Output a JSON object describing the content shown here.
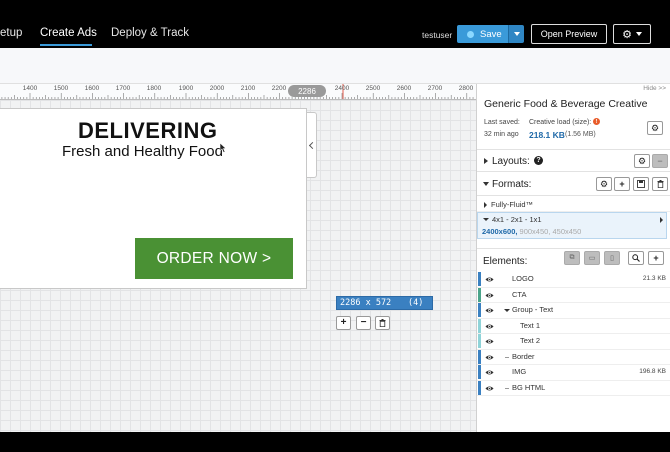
{
  "nav": {
    "tabs": [
      {
        "label": "etup"
      },
      {
        "label": "Create Ads"
      },
      {
        "label": "Deploy & Track"
      }
    ],
    "username": "testuser",
    "save_label": "Save",
    "preview_label": "Open Preview"
  },
  "ruler": {
    "labels": [
      "1400",
      "1500",
      "1600",
      "1700",
      "1800",
      "1900",
      "2000",
      "2100",
      "2200",
      "2400",
      "2500",
      "2600",
      "2700",
      "2800"
    ],
    "marker": "2286"
  },
  "ad": {
    "title": "DELIVERING",
    "subtitle": "Fresh and Healthy Food",
    "cta": "ORDER NOW >",
    "cta_color": "#4a9134"
  },
  "canvas": {
    "size_label": "2286 x 572",
    "size_count": "(4)",
    "tools": [
      "+",
      "−",
      "trash-icon"
    ]
  },
  "panel": {
    "hide_label": "Hide >>",
    "title": "Generic Food & Beverage Creative",
    "last_saved_label": "Last saved:",
    "last_saved_value": "32 min ago",
    "creative_load_label": "Creative load (size):",
    "creative_load_value": "218.1 KB",
    "creative_load_sub": "(1.56 MB)",
    "layouts_label": "Layouts:",
    "formats_label": "Formats:",
    "formats": [
      {
        "label": "Fully-Fluid™"
      },
      {
        "label": "4x1 - 2x1 - 1x1"
      }
    ],
    "format_sizes_active": "2400x600,",
    "format_sizes_rest": " 900x450, 450x450",
    "elements_label": "Elements:",
    "elements": [
      {
        "name": "LOGO",
        "size": "21.3 KB",
        "bar": "#3a80c1"
      },
      {
        "name": "CTA",
        "size": "",
        "bar": "#4aa48a"
      },
      {
        "name": "Group - Text",
        "size": "",
        "bar": "#3a80c1"
      },
      {
        "name": "Text 1",
        "size": "",
        "bar": "#8fd3d8"
      },
      {
        "name": "Text 2",
        "size": "",
        "bar": "#8fd3d8"
      },
      {
        "name": "Border",
        "size": "",
        "bar": "#3a80c1"
      },
      {
        "name": "IMG",
        "size": "196.8 KB",
        "bar": "#3a80c1"
      },
      {
        "name": "BG HTML",
        "size": "",
        "bar": "#3a80c1"
      }
    ]
  },
  "colors": {
    "accent": "#3a9ad9",
    "link": "#1f69a8"
  }
}
